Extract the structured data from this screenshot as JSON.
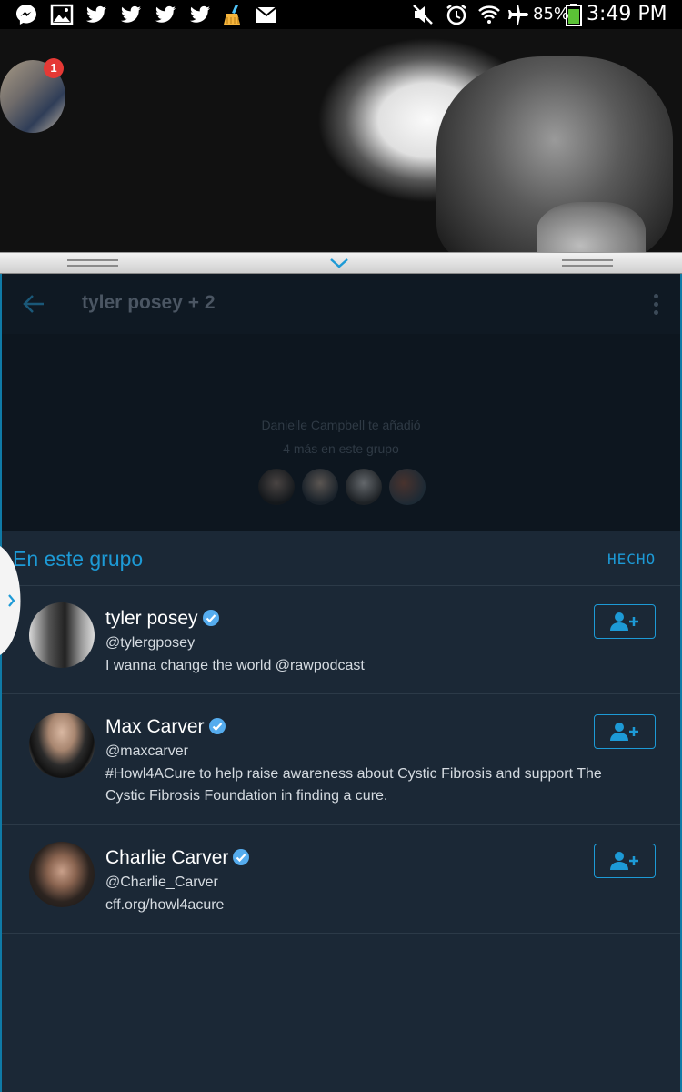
{
  "status_bar": {
    "battery": "85%",
    "time": "3:49 PM"
  },
  "chathead": {
    "badge_count": "1"
  },
  "conversation": {
    "title": "tyler posey + 2",
    "added_by": "Danielle Campbell te añadió",
    "more_in_group": "4 más en este grupo"
  },
  "group_panel": {
    "title": "En este grupo",
    "done_label": "HECHO",
    "members": [
      {
        "name": "tyler posey",
        "handle": "@tylergposey",
        "bio": "I wanna change the world @rawpodcast"
      },
      {
        "name": "Max Carver",
        "handle": "@maxcarver",
        "bio": "#Howl4ACure to help raise awareness about Cystic Fibrosis and support The Cystic Fibrosis Foundation in finding a cure."
      },
      {
        "name": "Charlie Carver",
        "handle": "@Charlie_Carver",
        "bio": "cff.org/howl4acure"
      }
    ]
  },
  "colors": {
    "accent": "#1d9ad6",
    "panel_bg": "#1b2836",
    "badge": "#e53935"
  },
  "icons": {
    "status_left": [
      "messenger-icon",
      "gallery-icon",
      "twitter-icon",
      "twitter-icon",
      "twitter-icon",
      "twitter-icon",
      "cleaner-icon",
      "mail-icon"
    ],
    "status_right": [
      "mute-icon",
      "alarm-icon",
      "wifi-icon",
      "airplane-icon",
      "battery-icon"
    ],
    "verified": "verified-badge-icon",
    "follow": "add-user-icon"
  }
}
